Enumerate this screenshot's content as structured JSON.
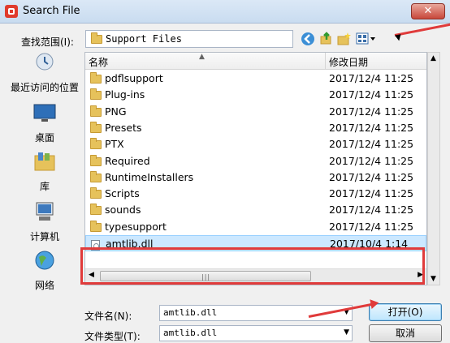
{
  "window": {
    "title": "Search File",
    "close_label": "✕"
  },
  "lookin": {
    "label": "查找范围(I):",
    "value": "Support Files"
  },
  "places": [
    {
      "label": "最近访问的位置",
      "icon": "recent-places-icon"
    },
    {
      "label": "桌面",
      "icon": "desktop-icon"
    },
    {
      "label": "库",
      "icon": "libraries-icon"
    },
    {
      "label": "计算机",
      "icon": "computer-icon"
    },
    {
      "label": "网络",
      "icon": "network-icon"
    }
  ],
  "list": {
    "col_name": "名称",
    "col_date": "修改日期",
    "rows": [
      {
        "name": "pdflsupport",
        "date": "2017/12/4 11:25",
        "icon": "folder-icon"
      },
      {
        "name": "Plug-ins",
        "date": "2017/12/4 11:25",
        "icon": "folder-icon"
      },
      {
        "name": "PNG",
        "date": "2017/12/4 11:25",
        "icon": "folder-icon"
      },
      {
        "name": "Presets",
        "date": "2017/12/4 11:25",
        "icon": "folder-icon"
      },
      {
        "name": "PTX",
        "date": "2017/12/4 11:25",
        "icon": "folder-icon"
      },
      {
        "name": "Required",
        "date": "2017/12/4 11:25",
        "icon": "folder-icon"
      },
      {
        "name": "RuntimeInstallers",
        "date": "2017/12/4 11:25",
        "icon": "folder-icon"
      },
      {
        "name": "Scripts",
        "date": "2017/12/4 11:25",
        "icon": "folder-icon"
      },
      {
        "name": "sounds",
        "date": "2017/12/4 11:25",
        "icon": "folder-icon"
      },
      {
        "name": "typesupport",
        "date": "2017/12/4 11:25",
        "icon": "folder-icon"
      },
      {
        "name": "amtlib.dll",
        "date": "2017/10/4 1:14",
        "icon": "dll-file-icon",
        "selected": true
      }
    ]
  },
  "filename": {
    "label": "文件名(N):",
    "value": "amtlib.dll"
  },
  "filetype": {
    "label": "文件类型(T):",
    "value": "amtlib.dll"
  },
  "buttons": {
    "open": "打开(O)",
    "cancel": "取消"
  },
  "colors": {
    "highlight": "#e03b3b",
    "selection": "#cce8ff",
    "titlebar": "#c9dcf0"
  }
}
